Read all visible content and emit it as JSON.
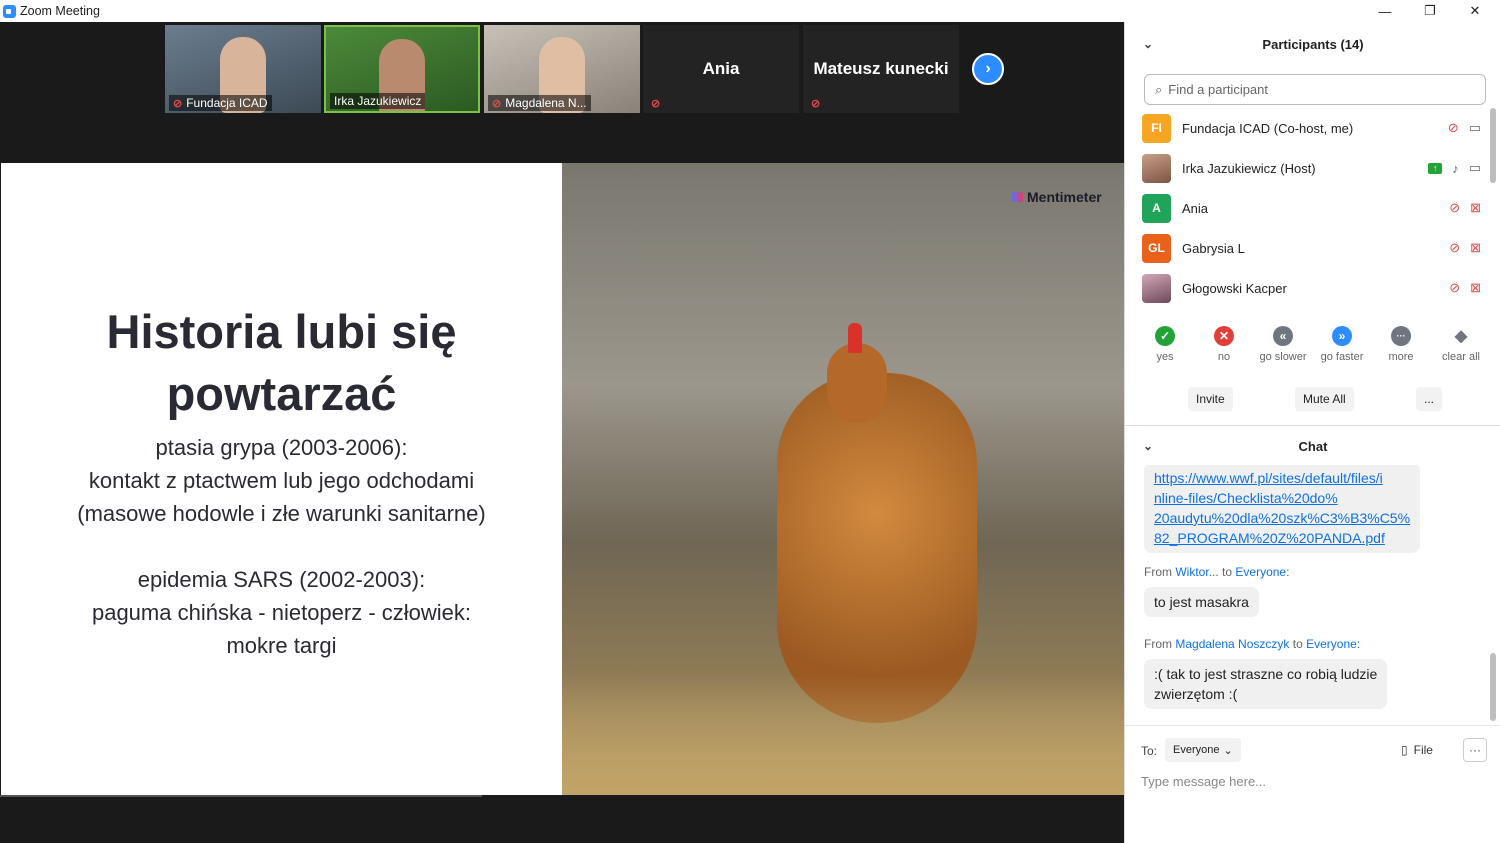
{
  "window": {
    "title": "Zoom Meeting",
    "minimize": "—",
    "maximize": "❐",
    "close": "✕"
  },
  "gallery": {
    "tiles": [
      {
        "name": "Fundacja ICAD"
      },
      {
        "name": "Irka Jazukiewicz"
      },
      {
        "name": "Magdalena N..."
      },
      {
        "name": "Ania"
      },
      {
        "name": "Mateusz kunecki"
      }
    ],
    "next_icon": "›"
  },
  "slide": {
    "title_line1": "Historia lubi się",
    "title_line2": "powtarzać",
    "body": [
      "ptasia grypa (2003-2006):",
      "kontakt z ptactwem lub jego odchodami",
      "(masowe hodowle i złe warunki sanitarne)",
      "",
      "epidemia SARS (2002-2003):",
      "paguma chińska - nietoperz - człowiek:",
      "mokre targi"
    ],
    "brand": "Mentimeter"
  },
  "participants_panel": {
    "title": "Participants (14)",
    "search_placeholder": "Find a participant",
    "list": [
      {
        "initials": "FI",
        "name": "Fundacja ICAD (Co-host, me)",
        "color": "#F5A623"
      },
      {
        "initials": "",
        "name": "Irka Jazukiewicz (Host)",
        "color": "#b98a6d"
      },
      {
        "initials": "A",
        "name": "Ania",
        "color": "#21A35A"
      },
      {
        "initials": "GL",
        "name": "Gabrysia  L",
        "color": "#E8621C"
      },
      {
        "initials": "",
        "name": "Głogowski Kacper",
        "color": "#a06a8a"
      }
    ],
    "reactions": [
      {
        "label": "yes",
        "glyph": "✓",
        "color": "#21A336"
      },
      {
        "label": "no",
        "glyph": "✕",
        "color": "#E0403A"
      },
      {
        "label": "go slower",
        "glyph": "«",
        "color": "#6E7680"
      },
      {
        "label": "go faster",
        "glyph": "»",
        "color": "#2D8CFF"
      },
      {
        "label": "more",
        "glyph": "···",
        "color": "#6E7680"
      },
      {
        "label": "clear all",
        "glyph": "◆",
        "color": "#6E7680"
      }
    ],
    "invite": "Invite",
    "mute_all": "Mute All",
    "more": "..."
  },
  "chat": {
    "title": "Chat",
    "link_lines": [
      "https://www.wwf.pl/sites/default/files/i",
      "nline-files/Checklista%20do%",
      "20audytu%20dla%20szk%C3%B3%C5%",
      "82_PROGRAM%20Z%20PANDA.pdf"
    ],
    "messages": [
      {
        "from_label": "From",
        "from": "Wiktor...",
        "to_label": "to",
        "to": "Everyone:",
        "text": "to jest masakra"
      },
      {
        "from_label": "From",
        "from": "Magdalena Noszczyk",
        "to_label": "to",
        "to": "Everyone:",
        "text_line1": ":( tak to jest straszne co robią ludzie",
        "text_line2": "zwierzętom :("
      }
    ],
    "to_label": "To:",
    "to_value": "Everyone",
    "file_label": "File",
    "more": "···",
    "placeholder": "Type message here..."
  }
}
